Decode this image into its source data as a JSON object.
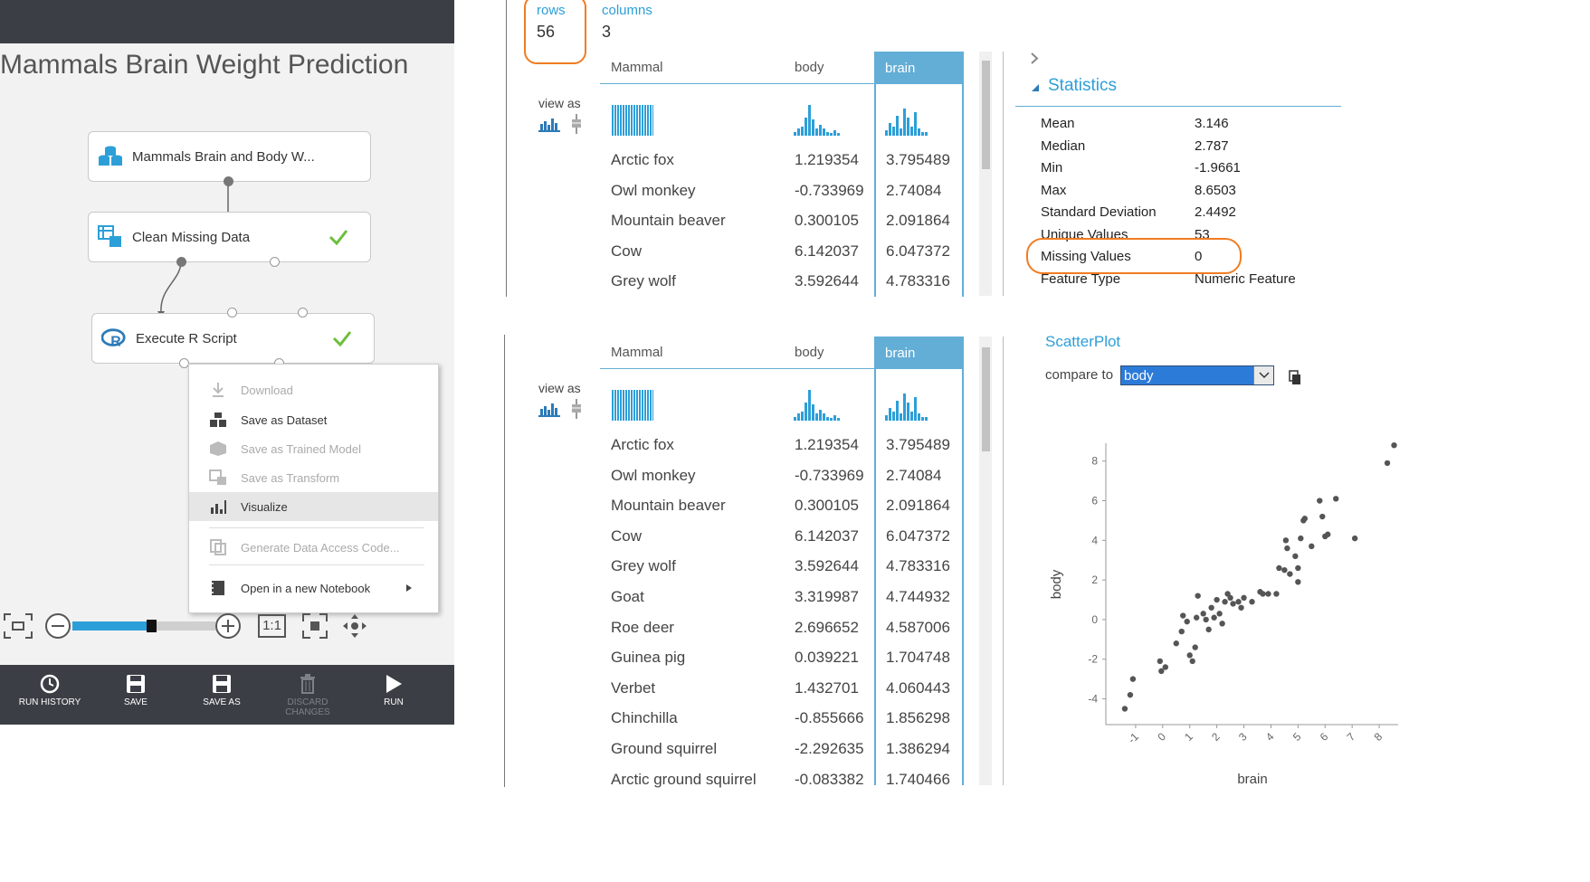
{
  "experiment": {
    "title": "Mammals Brain Weight Prediction",
    "modules": [
      {
        "label": "Mammals Brain and Body W...",
        "icon": "dataset-icon",
        "status": ""
      },
      {
        "label": "Clean Missing Data",
        "icon": "clean-data-icon",
        "status": "completed"
      },
      {
        "label": "Execute R Script",
        "icon": "r-logo-icon",
        "status": "completed"
      }
    ],
    "context_menu": [
      {
        "label": "Download",
        "icon": "download-icon",
        "enabled": false
      },
      {
        "label": "Save as Dataset",
        "icon": "save-dataset-icon",
        "enabled": true
      },
      {
        "label": "Save as Trained Model",
        "icon": "trained-model-icon",
        "enabled": false
      },
      {
        "label": "Save as Transform",
        "icon": "transform-icon",
        "enabled": false
      },
      {
        "label": "Visualize",
        "icon": "visualize-icon",
        "enabled": true,
        "highlighted": true
      },
      {
        "label": "Generate Data Access Code...",
        "icon": "code-icon",
        "enabled": false
      },
      {
        "label": "Open in a new Notebook",
        "icon": "notebook-icon",
        "enabled": true,
        "submenu": true
      }
    ],
    "zoom": {
      "zoom_level": 0.55,
      "actual_size_label": "1:1"
    },
    "commands": [
      {
        "label": "RUN HISTORY",
        "icon": "clock-icon",
        "enabled": true
      },
      {
        "label": "SAVE",
        "icon": "save-icon",
        "enabled": true
      },
      {
        "label": "SAVE AS",
        "icon": "save-as-icon",
        "enabled": true
      },
      {
        "label": "DISCARD CHANGES",
        "icon": "trash-icon",
        "enabled": false
      },
      {
        "label": "RUN",
        "icon": "play-icon",
        "enabled": true
      }
    ]
  },
  "dataset_summary": {
    "rows_label": "rows",
    "rows_value": "56",
    "columns_label": "columns",
    "columns_value": "3"
  },
  "table": {
    "view_as_label": "view as",
    "columns": [
      "Mammal",
      "body",
      "brain"
    ],
    "selected_column": "brain",
    "rows_top": [
      [
        "Arctic fox",
        "1.219354",
        "3.795489"
      ],
      [
        "Owl monkey",
        "-0.733969",
        "2.74084"
      ],
      [
        "Mountain beaver",
        "0.300105",
        "2.091864"
      ],
      [
        "Cow",
        "6.142037",
        "6.047372"
      ],
      [
        "Grey wolf",
        "3.592644",
        "4.783316"
      ]
    ],
    "rows_bottom": [
      [
        "Arctic fox",
        "1.219354",
        "3.795489"
      ],
      [
        "Owl monkey",
        "-0.733969",
        "2.74084"
      ],
      [
        "Mountain beaver",
        "0.300105",
        "2.091864"
      ],
      [
        "Cow",
        "6.142037",
        "6.047372"
      ],
      [
        "Grey wolf",
        "3.592644",
        "4.783316"
      ],
      [
        "Goat",
        "3.319987",
        "4.744932"
      ],
      [
        "Roe deer",
        "2.696652",
        "4.587006"
      ],
      [
        "Guinea pig",
        "0.039221",
        "1.704748"
      ],
      [
        "Verbet",
        "1.432701",
        "4.060443"
      ],
      [
        "Chinchilla",
        "-0.855666",
        "1.856298"
      ],
      [
        "Ground squirrel",
        "-2.292635",
        "1.386294"
      ],
      [
        "Arctic ground squirrel",
        "-0.083382",
        "1.740466"
      ]
    ]
  },
  "statistics": {
    "title": "Statistics",
    "items": [
      {
        "label": "Mean",
        "value": "3.146"
      },
      {
        "label": "Median",
        "value": "2.787"
      },
      {
        "label": "Min",
        "value": "-1.9661"
      },
      {
        "label": "Max",
        "value": "8.6503"
      },
      {
        "label": "Standard Deviation",
        "value": "2.4492"
      },
      {
        "label": "Unique Values",
        "value": "53"
      },
      {
        "label": "Missing Values",
        "value": "0"
      },
      {
        "label": "Feature Type",
        "value": "Numeric Feature"
      }
    ]
  },
  "scatter": {
    "title": "ScatterPlot",
    "compare_label": "compare to",
    "compare_value": "body"
  },
  "colors": {
    "accent": "#2d9fd8",
    "selected_header": "#63aed6",
    "highlight_box": "#f07c22",
    "bar_dark": "#3b3f45"
  },
  "chart_data": {
    "type": "scatter",
    "xlabel": "brain",
    "ylabel": "body",
    "x_ticks": [
      "-1",
      "0",
      "1",
      "2",
      "3",
      "4",
      "5",
      "6",
      "7",
      "8"
    ],
    "y_ticks": [
      "-4",
      "-2",
      "0",
      "2",
      "4",
      "6",
      "8"
    ],
    "xlim": [
      -2.1,
      8.7
    ],
    "ylim": [
      -5.3,
      8.9
    ],
    "points": [
      [
        -1.4,
        -4.5
      ],
      [
        -1.2,
        -3.8
      ],
      [
        -1.1,
        -3.0
      ],
      [
        -0.1,
        -2.1
      ],
      [
        -0.05,
        -2.6
      ],
      [
        0.1,
        -2.4
      ],
      [
        0.5,
        -1.2
      ],
      [
        0.7,
        -0.6
      ],
      [
        0.75,
        0.2
      ],
      [
        0.9,
        -0.1
      ],
      [
        1.0,
        -1.8
      ],
      [
        1.1,
        -2.1
      ],
      [
        1.2,
        -1.4
      ],
      [
        1.25,
        0.1
      ],
      [
        1.3,
        1.2
      ],
      [
        1.5,
        0.3
      ],
      [
        1.6,
        0.0
      ],
      [
        1.7,
        -0.5
      ],
      [
        1.8,
        0.6
      ],
      [
        1.9,
        0.1
      ],
      [
        2.0,
        1.0
      ],
      [
        2.1,
        0.3
      ],
      [
        2.2,
        -0.2
      ],
      [
        2.3,
        0.9
      ],
      [
        2.4,
        1.3
      ],
      [
        2.5,
        1.1
      ],
      [
        2.6,
        0.8
      ],
      [
        2.8,
        0.9
      ],
      [
        2.9,
        0.6
      ],
      [
        3.0,
        1.1
      ],
      [
        3.3,
        0.9
      ],
      [
        3.6,
        1.4
      ],
      [
        3.7,
        1.3
      ],
      [
        3.9,
        1.3
      ],
      [
        4.2,
        1.3
      ],
      [
        4.3,
        2.6
      ],
      [
        4.5,
        2.5
      ],
      [
        4.55,
        4.0
      ],
      [
        4.6,
        3.6
      ],
      [
        4.7,
        2.3
      ],
      [
        4.9,
        3.2
      ],
      [
        5.0,
        2.6
      ],
      [
        5.0,
        1.9
      ],
      [
        5.1,
        4.1
      ],
      [
        5.2,
        5.0
      ],
      [
        5.25,
        5.1
      ],
      [
        5.5,
        3.7
      ],
      [
        5.8,
        6.0
      ],
      [
        5.9,
        5.2
      ],
      [
        6.0,
        4.2
      ],
      [
        6.1,
        4.3
      ],
      [
        6.4,
        6.1
      ],
      [
        7.1,
        4.1
      ],
      [
        8.3,
        7.9
      ],
      [
        8.55,
        8.8
      ]
    ]
  }
}
